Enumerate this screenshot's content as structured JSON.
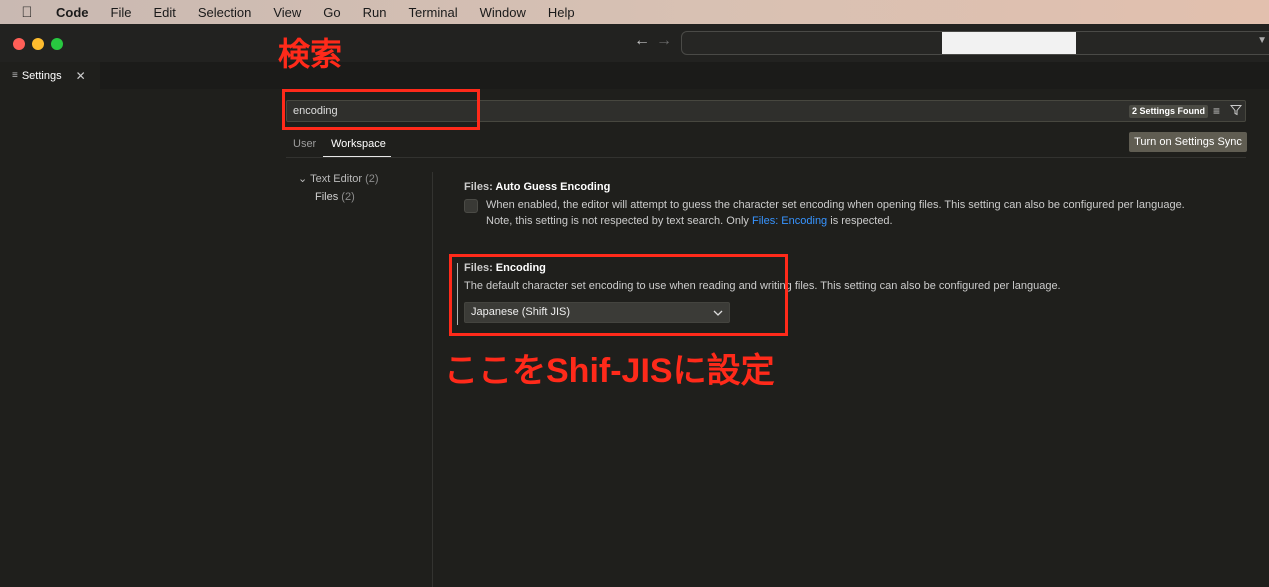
{
  "menubar": {
    "app": "Code",
    "items": [
      "File",
      "Edit",
      "Selection",
      "View",
      "Go",
      "Run",
      "Terminal",
      "Window",
      "Help"
    ]
  },
  "tab": {
    "label": "Settings",
    "close": "✕"
  },
  "search": {
    "value": "encoding",
    "result_badge": "2 Settings Found"
  },
  "scopes": {
    "user": "User",
    "workspace": "Workspace",
    "active": "Workspace"
  },
  "sync_button": "Turn on Settings Sync",
  "toc": {
    "group": "Text Editor",
    "group_count": "(2)",
    "child": "Files",
    "child_count": "(2)"
  },
  "settings": [
    {
      "category": "Files: ",
      "name": "Auto Guess Encoding",
      "checked": false,
      "desc_line1": "When enabled, the editor will attempt to guess the character set encoding when opening files. This setting can also be configured per language.",
      "desc_line2_pre": "Note, this setting is not respected by text search. Only ",
      "desc_link": "Files: Encoding",
      "desc_line2_post": " is respected."
    },
    {
      "category": "Files: ",
      "name": "Encoding",
      "desc": "The default character set encoding to use when reading and writing files. This setting can also be configured per language.",
      "value": "Japanese (Shift JIS)"
    }
  ],
  "annotations": {
    "search_label": "検索",
    "setting_label": "ここをShif-JISに設定",
    "color": "#ff2a1a"
  },
  "colors": {
    "accent_link": "#3794ff",
    "background": "#1f1f1c"
  },
  "icons": {
    "apple": "apple-logo-icon",
    "back": "arrow-left-icon",
    "forward": "arrow-right-icon",
    "settings_tab": "settings-list-icon",
    "clear": "clear-filter-icon",
    "filter": "filter-icon",
    "chevron": "chevron-down-icon"
  }
}
